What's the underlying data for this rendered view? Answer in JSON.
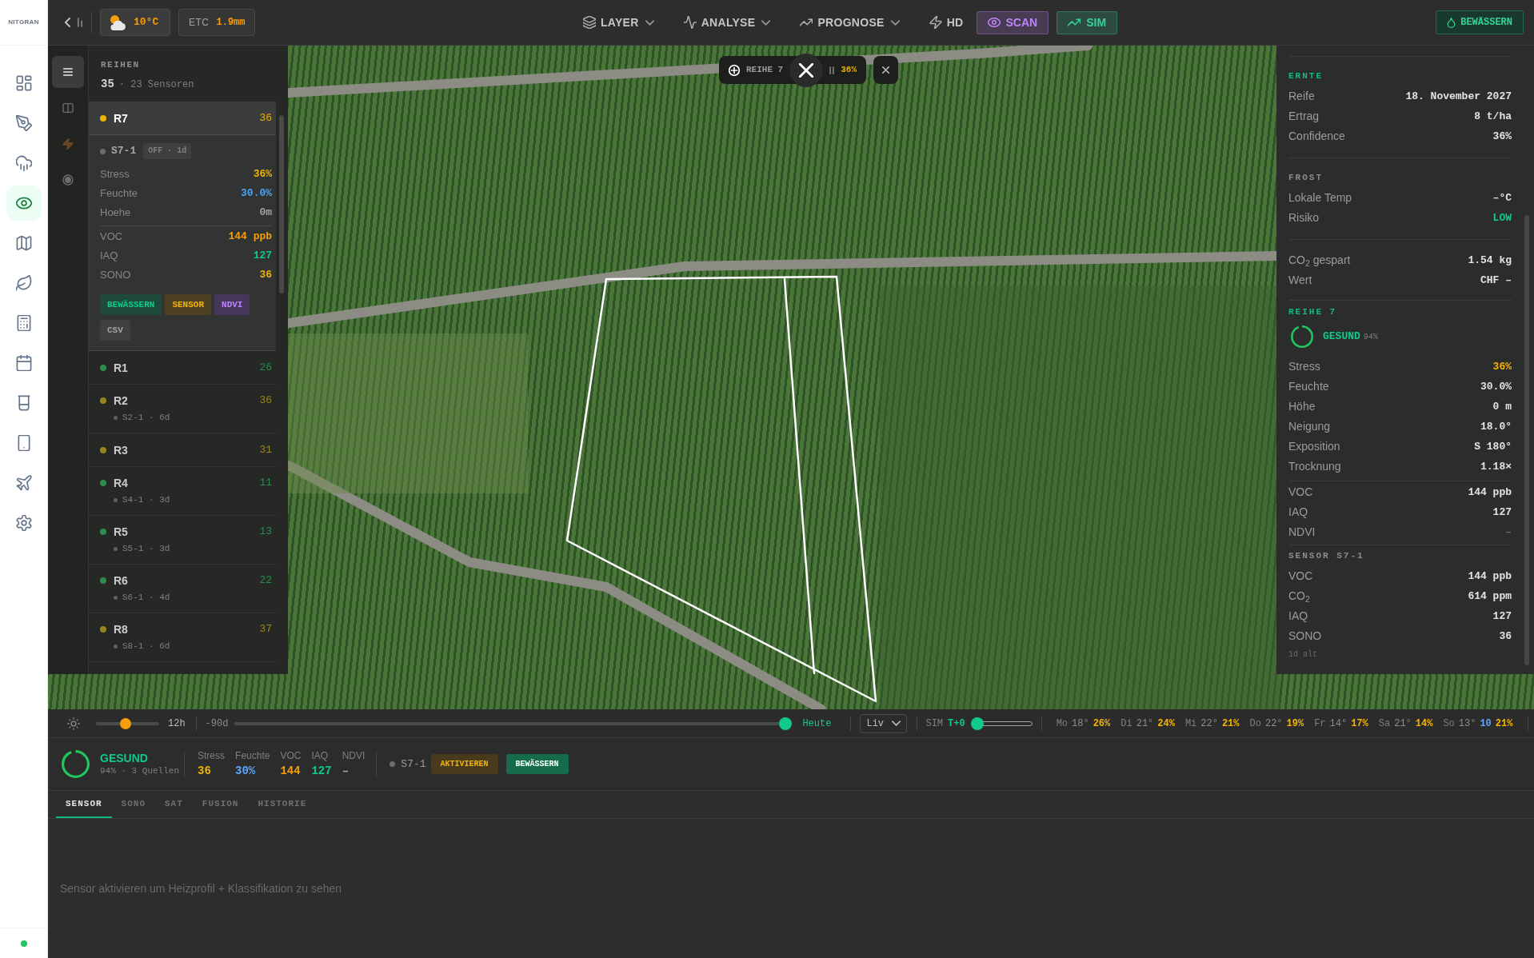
{
  "app": {
    "logo": "NITGRAN",
    "connected": true
  },
  "rail": {
    "items": [
      {
        "kind": "dashboard",
        "selected": false
      },
      {
        "kind": "pen",
        "selected": false
      },
      {
        "kind": "rain",
        "selected": false
      },
      {
        "kind": "eye",
        "selected": true
      },
      {
        "kind": "map",
        "selected": false
      },
      {
        "kind": "leaf",
        "selected": false
      },
      {
        "kind": "calculator",
        "selected": false
      },
      {
        "kind": "calendar",
        "selected": false
      },
      {
        "kind": "cup",
        "selected": false
      },
      {
        "kind": "tablet",
        "selected": false
      },
      {
        "kind": "plane",
        "selected": false
      },
      {
        "kind": "settings",
        "selected": false
      }
    ]
  },
  "top_bar": {
    "weather": {
      "temperature": "10°C"
    },
    "etc": {
      "label": "ETC",
      "value": "1.9mm"
    },
    "menus": [
      {
        "kind": "layers",
        "label": "LAYER",
        "dropdown": true
      },
      {
        "kind": "activity",
        "label": "ANALYSE",
        "dropdown": true
      },
      {
        "kind": "trend",
        "label": "PROGNOSE",
        "dropdown": true
      },
      {
        "kind": "bolt",
        "label": "HD",
        "dropdown": false
      }
    ],
    "modes": [
      {
        "kind": "eye",
        "label": "SCAN",
        "on": true,
        "color": "#c084fc"
      },
      {
        "kind": "trend",
        "label": "SIM",
        "on": true,
        "color": "#34d399"
      }
    ],
    "action": {
      "label": "BEWÄSSERN"
    }
  },
  "map": {
    "overlay": {
      "label": "REIHE 7",
      "value": "36%"
    }
  },
  "rows_panel": {
    "tabs": [
      {
        "kind": "list",
        "selected": true
      },
      {
        "kind": "columns",
        "selected": false
      },
      {
        "kind": "bolt",
        "selected": false
      },
      {
        "kind": "target",
        "selected": false
      }
    ],
    "title": "REIHEN",
    "count": "35",
    "sensors": "· 23 Sensoren",
    "rows": [
      {
        "name": "R7",
        "value": "36",
        "color": "#eab308",
        "selected": true,
        "expanded": true,
        "detail": {
          "active": false,
          "sensor": "S7-1",
          "badge": "OFF · 1d",
          "metrics": [
            {
              "label": "Stress",
              "value": "36%",
              "color": "#eab308"
            },
            {
              "label": "Feuchte",
              "value": "30.0%",
              "color": "#4fa3f0"
            },
            {
              "label": "Hoehe",
              "value": "0m",
              "color": "#a3a3a3"
            }
          ],
          "readings": [
            {
              "label": "VOC",
              "value": "144 ppb",
              "color": "#f59e0b"
            },
            {
              "label": "IAQ",
              "value": "127",
              "color": "#10c98a"
            },
            {
              "label": "SONO",
              "value": "36",
              "color": "#eab308"
            }
          ],
          "actions": [
            {
              "kind": "irrigate",
              "label": "BEWÄSSERN"
            },
            {
              "kind": "sensor",
              "label": "SENSOR"
            },
            {
              "kind": "ndvi",
              "label": "NDVI"
            },
            {
              "kind": "export",
              "label": "CSV"
            }
          ]
        }
      },
      {
        "name": "R1",
        "value": "26",
        "color": "#2e8b4e",
        "selected": false,
        "expanded": false
      },
      {
        "name": "R2",
        "value": "36",
        "color": "#9a8420",
        "selected": false,
        "expanded": false,
        "sensor": "S2-1 · 6d"
      },
      {
        "name": "R3",
        "value": "31",
        "color": "#9a8420",
        "selected": false,
        "expanded": false
      },
      {
        "name": "R4",
        "value": "11",
        "color": "#2e8b4e",
        "selected": false,
        "expanded": false,
        "sensor": "S4-1 · 3d"
      },
      {
        "name": "R5",
        "value": "13",
        "color": "#2e8b4e",
        "selected": false,
        "expanded": false,
        "sensor": "S5-1 · 3d"
      },
      {
        "name": "R6",
        "value": "22",
        "color": "#2e8b4e",
        "selected": false,
        "expanded": false,
        "sensor": "S6-1 · 4d"
      },
      {
        "name": "R8",
        "value": "37",
        "color": "#9a8420",
        "selected": false,
        "expanded": false,
        "sensor": "S8-1 · 6d"
      }
    ]
  },
  "right_panel": {
    "sections": [
      {
        "title": "ERNTE",
        "color": "#10b981",
        "rows": [
          {
            "label": "Reife",
            "value": "18. November 2027"
          },
          {
            "label": "Ertrag",
            "value": "8 t/ha"
          },
          {
            "label": "Confidence",
            "value": "36%"
          }
        ]
      },
      {
        "title": "FROST",
        "color": "#8a8d8a",
        "rows": [
          {
            "label": "Lokale Temp",
            "value": "–°C"
          },
          {
            "label": "Risiko",
            "value": "LOW",
            "color": "#10c98a"
          }
        ]
      },
      {
        "rows": [
          {
            "label": "CO$_{2}$ gespart",
            "value": "1.54 kg"
          },
          {
            "label": "Wert",
            "value": "CHF –"
          }
        ]
      },
      {
        "title": "REIHE 7",
        "color": "#10b981",
        "health": {
          "label": "GESUND",
          "value": "94%",
          "level": 0.94
        },
        "rows": [
          {
            "label": "Stress",
            "value": "36%",
            "color": "#f5b400"
          },
          {
            "label": "Feuchte",
            "value": "30.0%"
          },
          {
            "label": "Höhe",
            "value": "0 m"
          },
          {
            "label": "Neigung",
            "value": "18.0°"
          },
          {
            "label": "Exposition",
            "value": "S 180°"
          },
          {
            "label": "Trocknung",
            "value": "1.18×"
          }
        ]
      },
      {
        "rows": [
          {
            "label": "VOC",
            "value": "144 ppb"
          },
          {
            "label": "IAQ",
            "value": "127"
          },
          {
            "label": "NDVI",
            "value": "–",
            "color": "#6b6e6b"
          }
        ]
      },
      {
        "title": "SENSOR S7-1",
        "color": "#8a8d8a",
        "rows": [
          {
            "label": "VOC",
            "value": "144 ppb"
          },
          {
            "label": "CO$_{2}$",
            "value": "614 ppm"
          },
          {
            "label": "IAQ",
            "value": "127"
          },
          {
            "label": "SONO",
            "value": "36"
          }
        ],
        "footer": "1d alt"
      }
    ]
  },
  "timeline": {
    "brightness": {
      "level": 0.47,
      "reading": "12h"
    },
    "history": {
      "start": "-90d",
      "level": 1,
      "end": "Heute"
    },
    "mode": {
      "value": "Liv"
    },
    "sim": {
      "label": "SIM",
      "value": "T+0",
      "level": 0
    },
    "forecast": [
      {
        "day": "Mo",
        "temp": "18°",
        "chance": "26%"
      },
      {
        "day": "Di",
        "temp": "21°",
        "chance": "24%"
      },
      {
        "day": "Mi",
        "temp": "22°",
        "chance": "21%"
      },
      {
        "day": "Do",
        "temp": "22°",
        "chance": "19%"
      },
      {
        "day": "Fr",
        "temp": "14°",
        "chance": "17%"
      },
      {
        "day": "Sa",
        "temp": "21°",
        "chance": "14%"
      },
      {
        "day": "So",
        "temp": "13°",
        "rain": "10",
        "chance": "21%"
      }
    ]
  },
  "status_bar": {
    "health": {
      "label": "GESUND",
      "detail": "94% · 3 Quellen",
      "level": 0.94
    },
    "metrics": [
      {
        "label": "Stress",
        "value": "36",
        "color": "#eab308"
      },
      {
        "label": "Feuchte",
        "value": "30%",
        "color": "#60a5fa"
      },
      {
        "label": "VOC",
        "value": "144",
        "color": "#f59e0b"
      },
      {
        "label": "IAQ",
        "value": "127",
        "color": "#10c98a"
      },
      {
        "label": "NDVI",
        "value": "–",
        "color": "#a3a3a3"
      }
    ],
    "sensor": {
      "name": "S7-1",
      "active": false
    },
    "actions": [
      {
        "kind": "warning",
        "label": "AKTIVIEREN"
      },
      {
        "kind": "primary",
        "label": "BEWÄSSERN"
      }
    ]
  },
  "bottom": {
    "tabs": [
      {
        "label": "SENSOR",
        "selected": true
      },
      {
        "label": "SONO",
        "selected": false
      },
      {
        "label": "SAT",
        "selected": false
      },
      {
        "label": "FUSION",
        "selected": false
      },
      {
        "label": "HISTORIE",
        "selected": false
      }
    ],
    "message": "Sensor aktivieren um Heizprofil + Klassifikation zu sehen"
  }
}
